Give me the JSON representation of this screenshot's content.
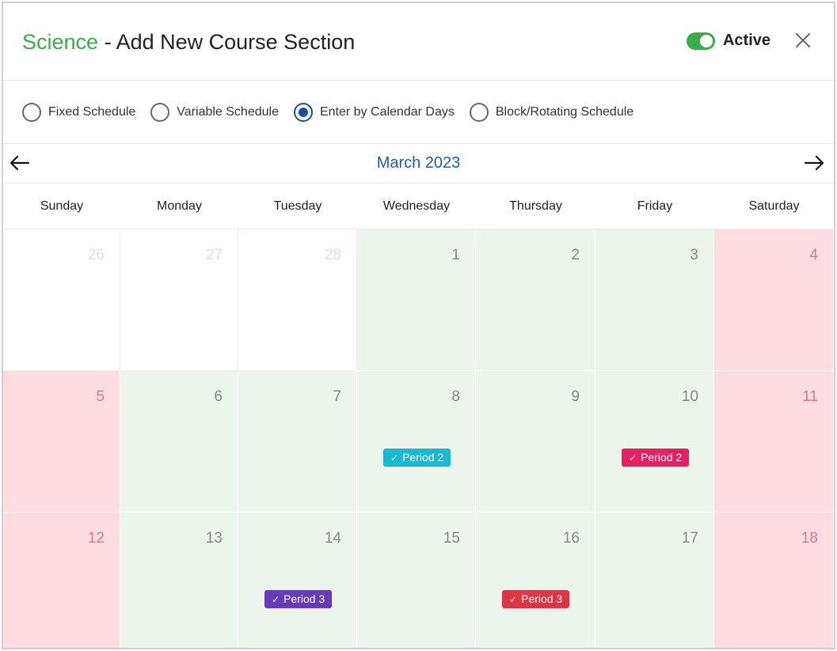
{
  "header": {
    "subject": "Science",
    "title_rest": " - Add New Course Section",
    "active_label": "Active"
  },
  "schedule_options": [
    {
      "label": "Fixed Schedule",
      "checked": false
    },
    {
      "label": "Variable Schedule",
      "checked": false
    },
    {
      "label": "Enter by Calendar Days",
      "checked": true
    },
    {
      "label": "Block/Rotating Schedule",
      "checked": false
    }
  ],
  "calendar": {
    "month_title": "March 2023",
    "weekdays": [
      "Sunday",
      "Monday",
      "Tuesday",
      "Wednesday",
      "Thursday",
      "Friday",
      "Saturday"
    ],
    "weeks": [
      [
        {
          "day": "26",
          "type": "other"
        },
        {
          "day": "27",
          "type": "other"
        },
        {
          "day": "28",
          "type": "other"
        },
        {
          "day": "1",
          "type": "school"
        },
        {
          "day": "2",
          "type": "school"
        },
        {
          "day": "3",
          "type": "school"
        },
        {
          "day": "4",
          "type": "weekend"
        }
      ],
      [
        {
          "day": "5",
          "type": "weekend"
        },
        {
          "day": "6",
          "type": "school"
        },
        {
          "day": "7",
          "type": "school"
        },
        {
          "day": "8",
          "type": "school",
          "badge": {
            "label": "Period 2",
            "color": "#1bb8d4"
          }
        },
        {
          "day": "9",
          "type": "school"
        },
        {
          "day": "10",
          "type": "school",
          "badge": {
            "label": "Period 2",
            "color": "#e91e63"
          }
        },
        {
          "day": "11",
          "type": "weekend"
        }
      ],
      [
        {
          "day": "12",
          "type": "weekend"
        },
        {
          "day": "13",
          "type": "school"
        },
        {
          "day": "14",
          "type": "school",
          "badge": {
            "label": "Period 3",
            "color": "#673ab7"
          }
        },
        {
          "day": "15",
          "type": "school"
        },
        {
          "day": "16",
          "type": "school",
          "badge": {
            "label": "Period 3",
            "color": "#dc3545"
          }
        },
        {
          "day": "17",
          "type": "school"
        },
        {
          "day": "18",
          "type": "weekend"
        }
      ]
    ]
  },
  "colors": {
    "accent_green": "#3bab4c",
    "radio_blue": "#1c4e9e",
    "month_blue": "#1e5fa8",
    "school_day": "#ecf5ec",
    "weekend_day": "#fedde2"
  }
}
